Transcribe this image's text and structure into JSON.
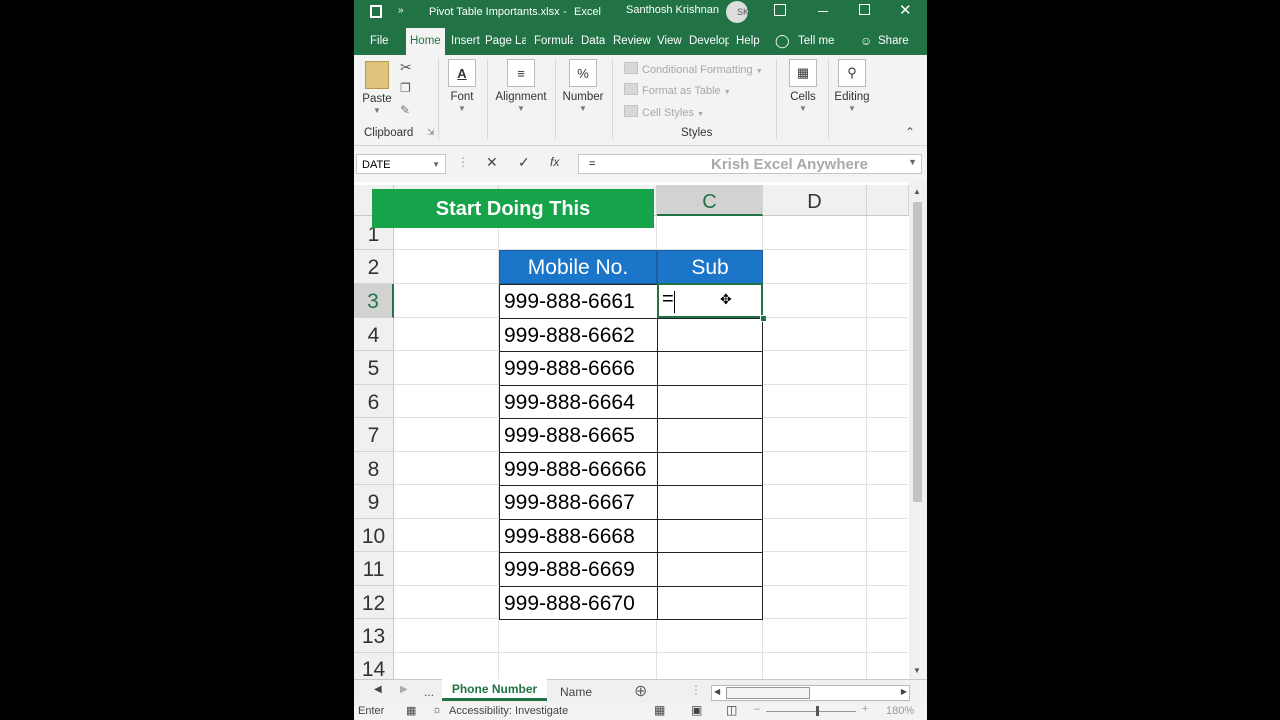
{
  "title_bar": {
    "file_name": "Pivot Table Importants.xlsx",
    "separator": "-",
    "app_name": "Excel",
    "user_name": "Santhosh Krishnan",
    "user_initials": "SK"
  },
  "ribbon_tabs": [
    "File",
    "Home",
    "Insert",
    "Page Lay",
    "Formula",
    "Data",
    "Review",
    "View",
    "Develop",
    "Help"
  ],
  "tell_me": "Tell me",
  "share": "Share",
  "ribbon": {
    "paste": "Paste",
    "clipboard": "Clipboard",
    "font": "Font",
    "alignment": "Alignment",
    "number": "Number",
    "conditional_formatting": "Conditional Formatting",
    "format_as_table": "Format as Table",
    "cell_styles": "Cell Styles",
    "styles": "Styles",
    "cells": "Cells",
    "editing": "Editing"
  },
  "formula_bar": {
    "name_box": "DATE",
    "content": "=",
    "watermark": "Krish Excel Anywhere"
  },
  "banner": "Start Doing This",
  "columns": [
    "C",
    "D"
  ],
  "rows": [
    "1",
    "2",
    "3",
    "4",
    "5",
    "6",
    "7",
    "8",
    "9",
    "10",
    "11",
    "12",
    "13",
    "14"
  ],
  "table": {
    "headers": [
      "Mobile No.",
      "Sub"
    ],
    "mobile_numbers": [
      "999-888-6661",
      "999-888-6662",
      "999-888-6666",
      "999-888-6664",
      "999-888-6665",
      "999-888-66666",
      "999-888-6667",
      "999-888-6668",
      "999-888-6669",
      "999-888-6670"
    ],
    "active_cell_text": "="
  },
  "sheet_tabs": {
    "ellipsis": "...",
    "active": "Phone Number",
    "other": "Name"
  },
  "status_bar": {
    "mode": "Enter",
    "accessibility": "Accessibility: Investigate",
    "zoom": "180%"
  }
}
